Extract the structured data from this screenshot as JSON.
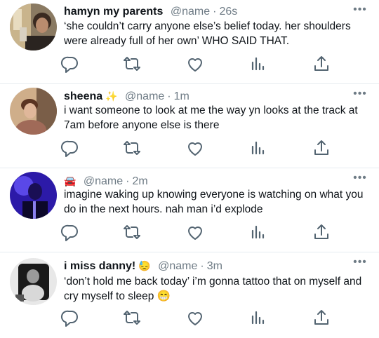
{
  "tweets": [
    {
      "name": "hamyn my parents",
      "name_emoji": "",
      "handle": "@name",
      "separator": "·",
      "time": "26s",
      "more": "•••",
      "text": "‘she couldn’t carry anyone else’s belief today. her shoulders were already full of her own’ WHO SAID THAT.",
      "avatar": "photo of person"
    },
    {
      "name": "sheena",
      "name_emoji": "✨",
      "handle": "@name",
      "separator": "·",
      "time": "1m",
      "more": "•••",
      "text": "i want someone to look at me the way yn looks at the track at 7am before anyone else is there",
      "avatar": "photo of person"
    },
    {
      "name": "",
      "name_emoji": "🚘",
      "handle": "@name",
      "separator": "·",
      "time": "2m",
      "more": "•••",
      "text": "imagine waking up knowing everyone is watching on what you do in the next hours. nah man i’d explode",
      "avatar": "photo of person"
    },
    {
      "name": "i miss danny!",
      "name_emoji": "😓",
      "handle": "@name",
      "separator": "·",
      "time": "3m",
      "more": "•••",
      "text": "‘don’t hold me back today’ i’m gonna tattoo that on myself and cry myself to sleep 😁",
      "avatar": "photo of person"
    }
  ],
  "colors": {
    "text": "#0f1419",
    "secondary": "#6e7b85",
    "divider": "#e6ecf0",
    "icon": "#536471"
  },
  "icons": [
    "reply-icon",
    "retweet-icon",
    "like-icon",
    "views-icon",
    "share-icon",
    "more-icon"
  ]
}
